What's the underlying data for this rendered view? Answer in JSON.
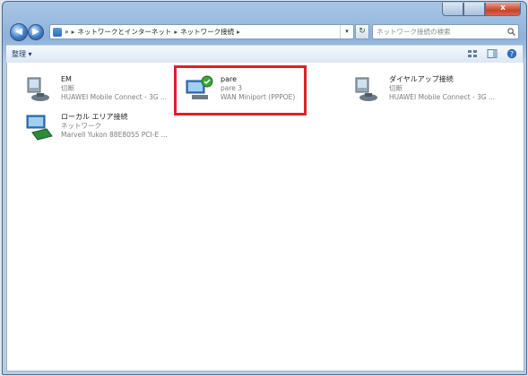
{
  "window": {
    "close_glyph": "x",
    "accent_color": "#e0202a"
  },
  "address_bar": {
    "root_glyph": "»",
    "crumbs": [
      "ネットワークとインターネット",
      "ネットワーク接続"
    ],
    "dropdown_glyph": "▾"
  },
  "nav": {
    "back_glyph": "◀",
    "forward_glyph": "▶",
    "refresh_glyph": "↻"
  },
  "search": {
    "placeholder": "ネットワーク接続の検索"
  },
  "command_bar": {
    "organize_label": "整理 ▾"
  },
  "connections": [
    {
      "name": "EM",
      "status": "切断",
      "device": "HUAWEI Mobile Connect - 3G ..."
    },
    {
      "name": "pare",
      "status": "pare 3",
      "device": "WAN Miniport (PPPOE)"
    },
    {
      "name": "ダイヤルアップ接続",
      "status": "切断",
      "device": "HUAWEI Mobile Connect - 3G ..."
    },
    {
      "name": "ローカル エリア接続",
      "status": "ネットワーク",
      "device": "Marvell Yukon 88E8055 PCI-E ..."
    }
  ],
  "icons": {
    "modem": "modem-icon",
    "broadband": "broadband-connection-icon",
    "lan": "lan-adapter-icon"
  }
}
